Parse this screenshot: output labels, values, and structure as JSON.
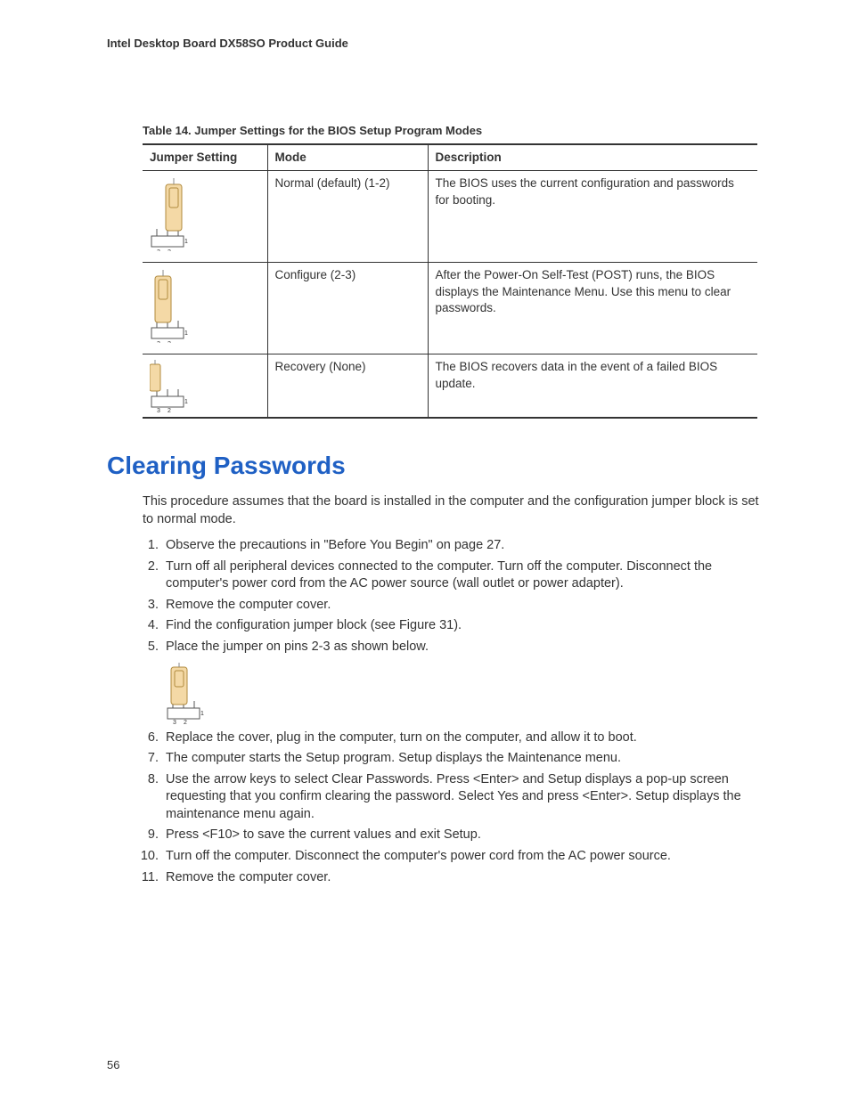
{
  "header": "Intel Desktop Board DX58SO Product Guide",
  "table_caption": "Table 14. Jumper Settings for the BIOS Setup Program Modes",
  "table": {
    "headers": [
      "Jumper Setting",
      "Mode",
      "Description"
    ],
    "rows": [
      {
        "mode": "Normal (default) (1-2)",
        "desc": "The BIOS uses the current configuration and passwords for booting."
      },
      {
        "mode": "Configure (2-3)",
        "desc": "After the Power-On Self-Test (POST) runs, the BIOS displays the Maintenance Menu.  Use this menu to clear passwords."
      },
      {
        "mode": "Recovery (None)",
        "desc": "The BIOS recovers data in the event of a failed BIOS update."
      }
    ]
  },
  "section_title": "Clearing Passwords",
  "intro": "This procedure assumes that the board is installed in the computer and the configuration jumper block is set to normal mode.",
  "steps": [
    "Observe the precautions in \"Before You Begin\" on page 27.",
    "Turn off all peripheral devices connected to the computer.  Turn off the computer. Disconnect the computer's power cord from the AC power source (wall outlet or power adapter).",
    "Remove the computer cover.",
    "Find the configuration jumper block (see Figure 31).",
    "Place the jumper on pins 2-3 as shown below.",
    "Replace the cover, plug in the computer, turn on the computer, and allow it to boot.",
    "The computer starts the Setup program.  Setup displays the Maintenance menu.",
    "Use the arrow keys to select Clear Passwords.  Press <Enter> and Setup displays a pop-up screen requesting that you confirm clearing the password.  Select Yes and press <Enter>.  Setup displays the maintenance menu again.",
    "Press <F10> to save the current values and exit Setup.",
    "Turn off the computer.  Disconnect the computer's power cord from the AC power source.",
    "Remove the computer cover."
  ],
  "page_number": "56"
}
